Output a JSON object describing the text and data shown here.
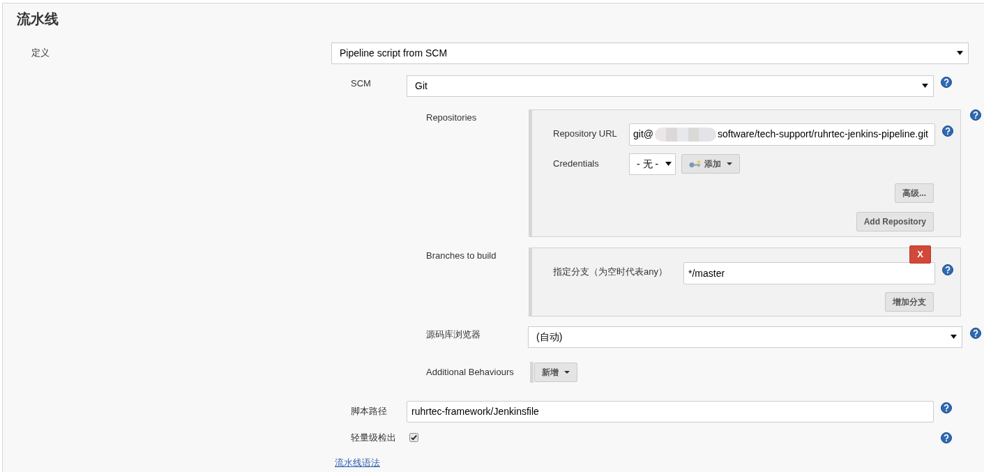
{
  "section": {
    "title": "流水线"
  },
  "definition": {
    "label": "定义",
    "value": "Pipeline script from SCM"
  },
  "scm": {
    "label": "SCM",
    "value": "Git"
  },
  "repositories": {
    "label": "Repositories",
    "url_label": "Repository URL",
    "url_prefix": "git@",
    "url_suffix": "software/tech-support/ruhrtec-jenkins-pipeline.git",
    "credentials_label": "Credentials",
    "credentials_value": "- 无 -",
    "add_button": "添加",
    "advanced_button": "高级...",
    "add_repository_button": "Add Repository"
  },
  "branches": {
    "label": "Branches to build",
    "delete_button": "X",
    "branch_label": "指定分支（为空时代表any）",
    "branch_value": "*/master",
    "add_branch_button": "增加分支"
  },
  "repository_browser": {
    "label": "源码库浏览器",
    "value": "(自动)"
  },
  "additional_behaviours": {
    "label": "Additional Behaviours",
    "add_button": "新增"
  },
  "script_path": {
    "label": "脚本路径",
    "value": "ruhrtec-framework/Jenkinsfile"
  },
  "lightweight_checkout": {
    "label": "轻量级检出",
    "checked": true
  },
  "syntax_link": "流水线语法"
}
